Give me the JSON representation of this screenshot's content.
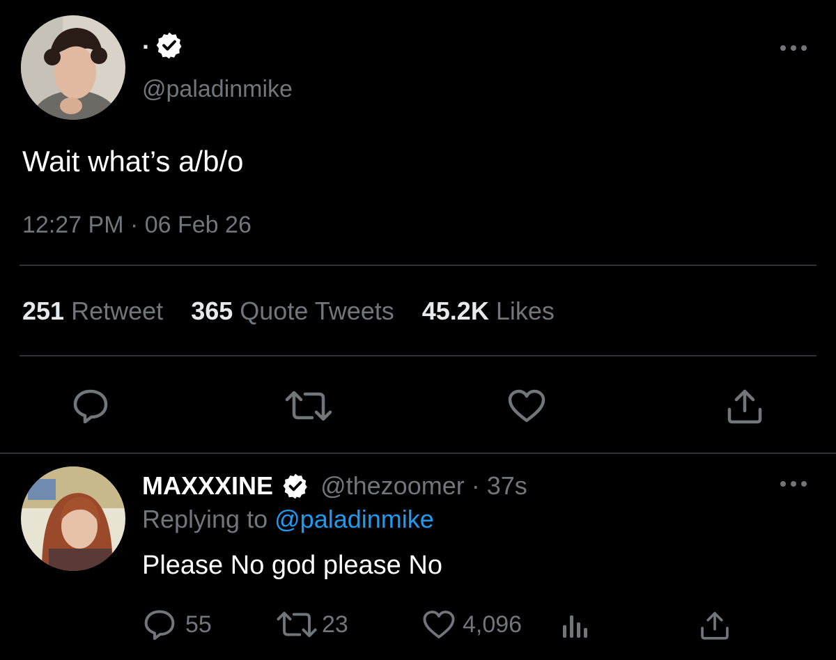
{
  "main_tweet": {
    "display_name": ".",
    "handle": "@paladinmike",
    "text": "Wait what’s a/b/o",
    "timestamp": "12:27 PM · 06 Feb 26",
    "stats": [
      {
        "value": "251",
        "label": "Retweet"
      },
      {
        "value": "365",
        "label": "Quote Tweets"
      },
      {
        "value": "45.2K",
        "label": "Likes"
      }
    ],
    "actions": {
      "reply_icon": "reply-icon",
      "retweet_icon": "retweet-icon",
      "like_icon": "heart-icon",
      "share_icon": "share-icon"
    }
  },
  "reply_tweet": {
    "display_name": "MAXXXINE",
    "handle": "@thezoomer",
    "time_ago": "· 37s",
    "replying_prefix": "Replying to",
    "replying_to": "@paladinmike",
    "text": "Please No god please No",
    "counts": {
      "replies": "55",
      "retweets": "23",
      "likes": "4,096"
    }
  },
  "colors": {
    "background": "#000000",
    "text": "#e7e9ea",
    "muted": "#71767b",
    "link": "#1d9bf0",
    "divider": "#2f3336"
  }
}
